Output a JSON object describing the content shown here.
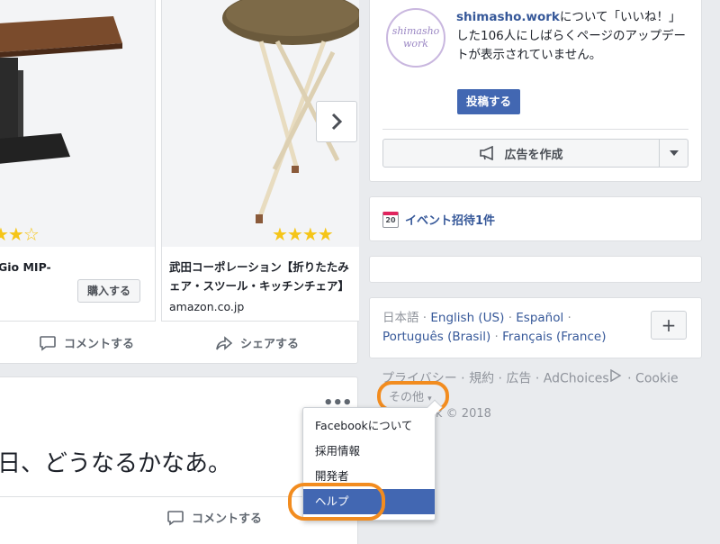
{
  "feed": {
    "product1": {
      "stars": "★★☆",
      "title": "Gio MIP-",
      "buy_label": "購入する"
    },
    "product2": {
      "stars": "★★★★",
      "title_line1": "武田コーポレーション【折りたたみ",
      "title_line2": "ェア・スツール・キッチンチェア】",
      "domain": "amazon.co.jp"
    },
    "actions": {
      "comment_label": "コメントする",
      "share_label": "シェアする"
    },
    "post2": {
      "more_dots": "•••",
      "text": "日、どうなるかなあ。",
      "comment_label": "コメントする",
      "footer_partial": "k © 2018"
    }
  },
  "promo": {
    "logo_line1": "shimasho",
    "logo_line2": "work",
    "site": "shimasho.work",
    "text": "について「いいね！」した106人にしばらくページのアップデートが表示されていません。",
    "post_button": "投稿する",
    "create_ad_button": "広告を作成"
  },
  "event": {
    "cal_day": "20",
    "label": "イベント招待1件"
  },
  "languages": {
    "current": "日本語",
    "sep": " · ",
    "items": [
      "English (US)",
      "Español",
      "Português (Brasil)",
      "Français (France)"
    ],
    "add_label": "+"
  },
  "footer": {
    "links": "プライバシー · 規約 · 広告 · AdChoices",
    "cookie": " · Cookie",
    "more": "その他",
    "copyright": "Facebook © 2018"
  },
  "menu": {
    "items": [
      "Facebookについて",
      "採用情報",
      "開発者",
      "ヘルプ"
    ]
  },
  "colors": {
    "brand": "#4267b2",
    "link": "#365899",
    "highlight": "#f28c1f"
  }
}
